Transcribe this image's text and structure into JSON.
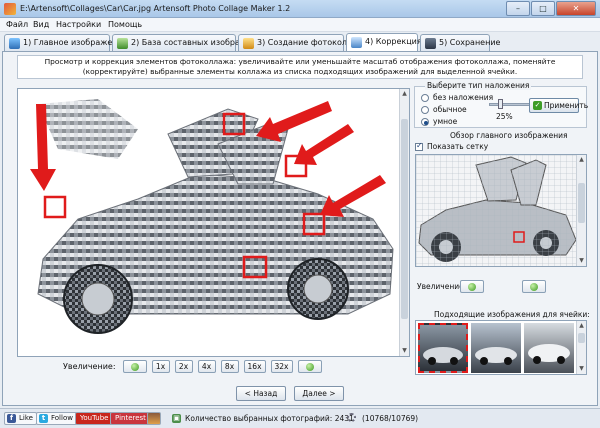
{
  "window": {
    "title": "E:\\Artensoft\\Collages\\Car\\Car.jpg Artensoft Photo Collage Maker 1.2",
    "minimize": "–",
    "maximize": "□",
    "close": "✕"
  },
  "menu": [
    "Файл",
    "Вид",
    "Настройки",
    "Помощь"
  ],
  "tabs": [
    {
      "label": "1) Главное изображение"
    },
    {
      "label": "2) База составных изображений"
    },
    {
      "label": "3) Создание фотоколлажа"
    },
    {
      "label": "4) Коррекция",
      "active": true
    },
    {
      "label": "5) Сохранение"
    }
  ],
  "instruction": "Просмотр и коррекция элементов фотоколлажа: увеличивайте или уменьшайте масштаб отображения фотоколлажа, поменяйте (корректируйте) выбранные элементы коллажа из списка подходящих изображений для выделенной ячейки.",
  "zoom": {
    "label": "Увеличение:",
    "levels": [
      "1x",
      "2x",
      "4x",
      "8x",
      "16x",
      "32x"
    ]
  },
  "nav": {
    "back": "< Назад",
    "next": "Далее >"
  },
  "overlay": {
    "title": "Выберите тип наложения",
    "options": [
      "без наложения",
      "обычное",
      "умное"
    ],
    "selected": 2,
    "percent": "25%",
    "apply": "Применить",
    "level": 0.25
  },
  "overview": {
    "title": "Обзор главного изображения",
    "show_grid": "Показать сетку",
    "zoom_label": "Увеличение"
  },
  "suitable": {
    "title": "Подходящие изображения для ячейки:"
  },
  "status": {
    "like": "Like",
    "follow": "Follow",
    "youtube": "YouTube",
    "pinterest": "Pinterest",
    "count_label": "Количество выбранных фотографий: 2431",
    "progress": "(10768/10769)"
  },
  "colors": {
    "accent_red": "#e01b1b",
    "green": "#3b9a1d",
    "blue": "#1d4d8a"
  }
}
